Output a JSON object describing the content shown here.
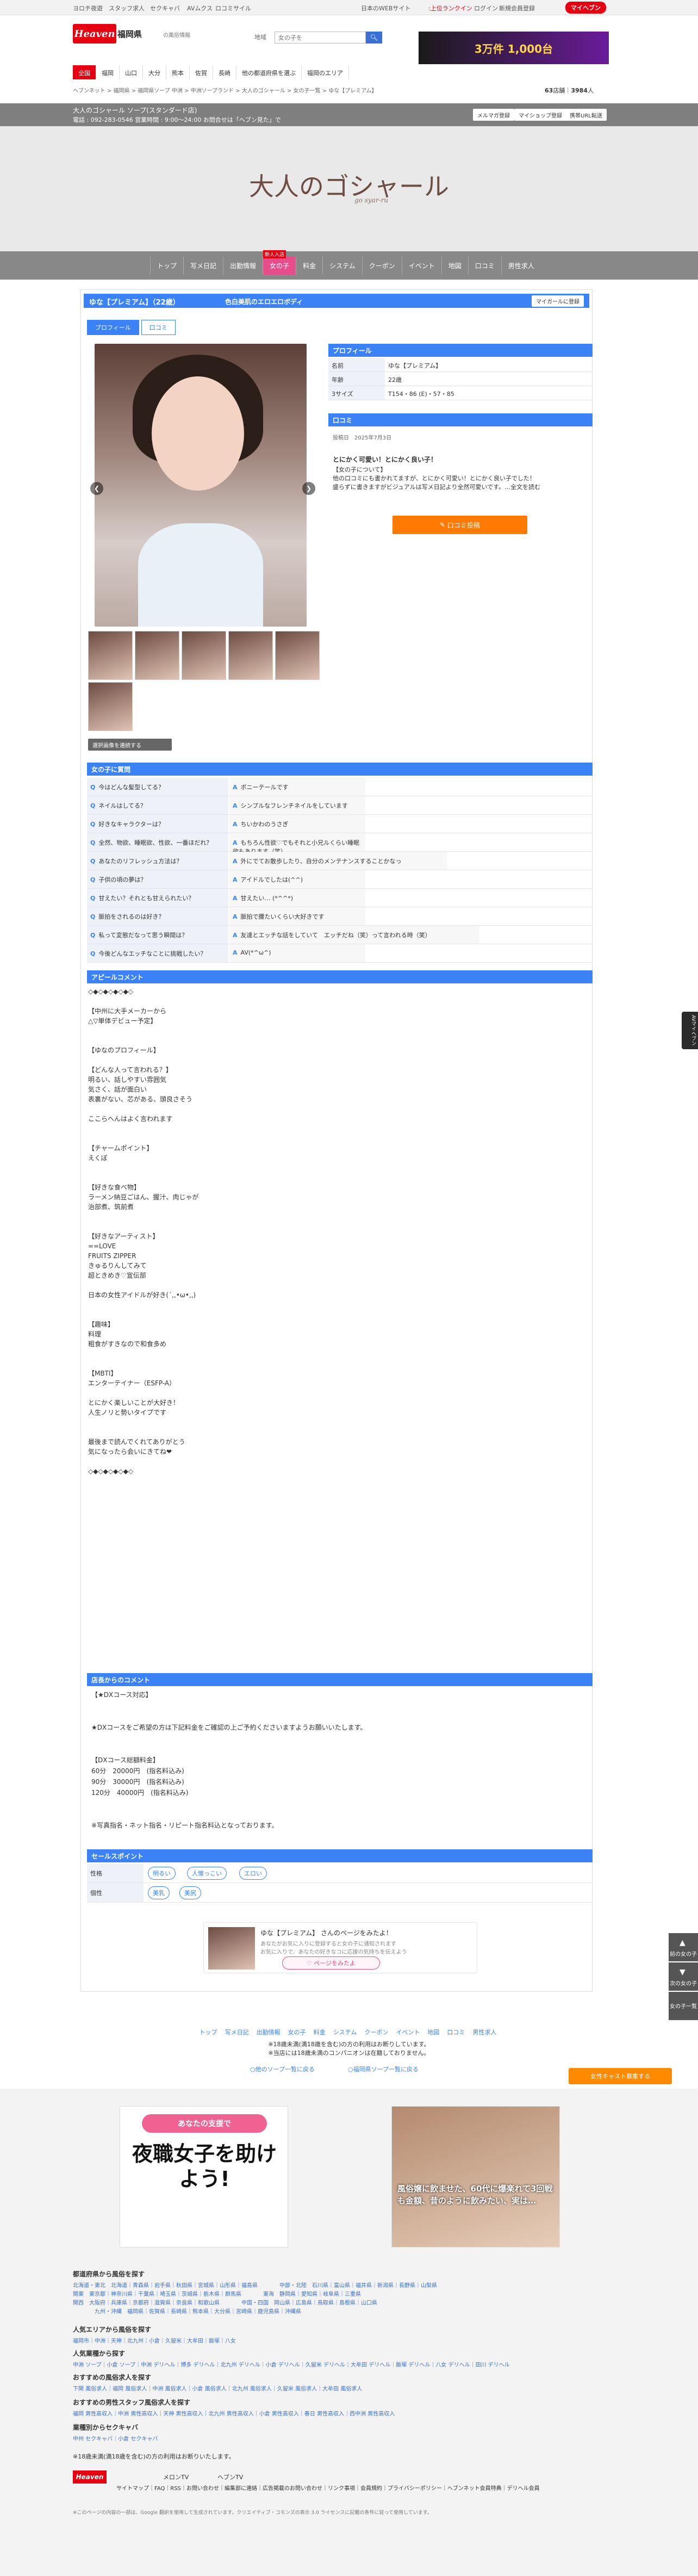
{
  "top": {
    "links": [
      "ヨロチ夜遊",
      "スタッフ求人",
      "セクキャバ",
      "AVムクス",
      "ロコミサイル"
    ],
    "right": [
      "日本のWEBサイト",
      ":上位ランクイン",
      "ログイン",
      "新規会員登録",
      "マイヘブン"
    ]
  },
  "header": {
    "logo": "Heaven",
    "pref": "福岡県",
    "pref_sub": "の風俗情報",
    "search_label": "地域",
    "search_placeholder": "女の子を",
    "banner": "3万件 1,000台",
    "nav": [
      "全国",
      "福岡",
      "山口",
      "大分",
      "熊本",
      "佐賀",
      "長崎",
      "他の都道府県を選ぶ",
      "福岡のエリア"
    ],
    "breadcrumb": "ヘブンネット > 福岡県 > 福岡県ソープ 中洲 > 中洲ソープランド > 大人のゴシャール > 女の子一覧 > ゆな【プレミアム】",
    "shop_count": "63",
    "count_suffix": "店舗",
    "total": "3984",
    "total_suffix": "人"
  },
  "shop": {
    "name": "大人のゴシャール ソープ(スタンダード店)",
    "info": "電話 : 092-283-0546 営業時間 : 9:00〜24:00 お問合せは「ヘブン見た」で",
    "buttons": [
      "メルマガ登録",
      "マイショップ登録",
      "携帯URL転送"
    ],
    "logo_text": "大人のゴシャール",
    "logo_sub": "go syar-ru",
    "nav": [
      "トップ",
      "写メ日記",
      "出勤情報",
      "女の子",
      "料金",
      "システム",
      "クーポン",
      "イベント",
      "地図",
      "口コミ",
      "男性求人"
    ],
    "nav_badge": "新人入店"
  },
  "girl": {
    "title": "ゆな【プレミアム】（22歳）",
    "catch": "色白美肌のエロエロボディ",
    "mag_btn": "マイガールに登録",
    "tabs": [
      "プロフィール",
      "口コミ"
    ],
    "all_photos": "選択画像を連続する"
  },
  "profile": {
    "heading": "プロフィール",
    "rows": [
      {
        "k": "名前",
        "v": "ゆな【プレミアム】"
      },
      {
        "k": "年齢",
        "v": "22歳"
      },
      {
        "k": "3サイズ",
        "v": "T154・86 (E)・57・85"
      }
    ]
  },
  "review": {
    "heading": "口コミ",
    "date_label": "投稿日",
    "date": "2025年7月3日",
    "title": "とにかく可愛い！とにかく良い子！",
    "body": "【女の子について】\n他の口コミにも書かれてますが、とにかく可愛い！とにかく良い子でした！\n盛らずに書きますがビジュアルは写メ日記より全然可愛いです。…全文を読む",
    "btn": "口コミ投稿"
  },
  "qa": {
    "heading": "女の子に質問",
    "items": [
      {
        "q": "今はどんな髪型してる？",
        "a": "ボニーテールです"
      },
      {
        "q": "ネイルはしてる？",
        "a": "シンプルなフレンチネイルをしています"
      },
      {
        "q": "好きなキャラクターは？",
        "a": "ちいかわのうさぎ"
      },
      {
        "q": "全然、物欲、睡眠欲、性欲、一番ほだれ？",
        "a": "もちろん性欲♡でもそれと小兄ルくらい睡眠欲もあります（笑）"
      },
      {
        "q": "あなたのリフレッシュ方法は？",
        "a": "外にでてお散歩したり、自分のメンテナンスすることかなっ"
      },
      {
        "q": "子供の頃の夢は？",
        "a": "アイドルでしたは(^^)"
      },
      {
        "q": "甘えたい？それとも甘えられたい？",
        "a": "甘えたい… (*^^*)"
      },
      {
        "q": "脈拍をされるのは好き？",
        "a": "脈拍で腰たいくらい大好きです"
      },
      {
        "q": "私って変態だなって思う瞬間は？",
        "a": "友達とエッチな話をしていて　エッチだね（笑）って言われる時（笑）"
      },
      {
        "q": "今後どんなエッチなことに挑戦したい？",
        "a": "AV(*^ω^)"
      }
    ]
  },
  "appeal": {
    "heading": "アピールコメント",
    "text": "◇◆◇◆◇◆◇◆◇\n\n【中州に大手メーカーから\n△▽単体デビュー予定】\n\n\n【ゆなのプロフィール】\n\n【どんな人って言われる？】\n明るい、話しやすい雰囲気\n気さく、話が面白い\n表裏がない、芯がある、頭良さそう\n\nここらへんはよく言われます\n\n\n【チャームポイント】\nえくぼ\n\n\n【好きな食べ物】\nラーメン納豆ごはん、握汁、肉じゃが\n治部煮、筑前煮\n\n\n【好きなアーティスト】\n==LOVE\nFRUITS ZIPPER\nきゅるりんしてみて\n超ときめき♡宣伝部\n\n日本の女性アイドルが好き(´,,•ω•,,)\n\n\n【趣味】\n料理\n粗食がすきなので和食多め\n\n\n【MBTI】\nエンターテイナー（ESFP-A）\n\nとにかく楽しいことが大好き！\n人生ノリと勢いタイプです\n\n\n最後まで読んでくれてありがとう\n気になったら会いにきてね❤\n\n◇◆◇◆◇◆◇◆◇"
  },
  "shop_comment": {
    "heading": "店長からのコメント",
    "text": "【★DXコース対応】\n\n\n★DXコースをご希望の方は下記料金をご確認の上ご予約くださいますようお願いいたします。\n\n\n【DXコース総額料金】\n60分　20000円　(指名料込み)\n90分　30000円　(指名料込み)\n120分　40000円　(指名料込み)\n\n\n※写真指名・ネット指名・リピート指名料込となっております。"
  },
  "sales": {
    "heading": "セールスポイント",
    "rows": [
      {
        "k": "性格",
        "tags": [
          "明るい",
          "人懐っこい",
          "エロい"
        ]
      },
      {
        "k": "個性",
        "tags": [
          "美乳",
          "美尻"
        ]
      }
    ]
  },
  "fav": {
    "title": "ゆな【プレミアム】 さんのページをみたよ！",
    "sub": "あなたがお気に入りに登録すると女の子に通知されます\nお気に入りで、あなたの好きなコに応援の気持ちを伝えよう",
    "btn": "ページをみたよ"
  },
  "footer_nav": [
    "トップ",
    "写メ日記",
    "出勤情報",
    "女の子",
    "料金",
    "システム",
    "クーポン",
    "イベント",
    "地図",
    "口コミ",
    "男性求人"
  ],
  "notes": [
    "※18歳未満(満18歳を含む)の方の利用はお断りしています。",
    "※当店には18歳未満のコンパニオンは在籍しておりません。"
  ],
  "links": [
    "○他のソープ一覧に戻る",
    "○福岡県ソープ一覧に戻る"
  ],
  "side": {
    "prev": "前の女の子",
    "next": "次の女の子",
    "list": "女の子一覧",
    "pill": "AVマイヘブン"
  },
  "recruit_btn": "女性キャスト募集する",
  "ads": {
    "ad1_top": "あなたの支援で",
    "ad1_main": "夜職女子を助けよう!",
    "ad2_text": "風俗嬢に飲ませた、60代に爆楽れて3回戦も金額、昔のように飲みたい、実は…"
  },
  "footer": {
    "sections": [
      {
        "h": "都道府県から風俗を探す",
        "l": "北海道・東北　北海道｜青森県｜岩手県｜秋田県｜宮城県｜山形県｜福島県　　　　中部・北陸　石川県｜富山県｜福井県｜新潟県｜長野県｜山梨県\n関東　東京都｜神奈川県｜千葉県｜埼玉県｜茨城県｜栃木県｜群馬県　　　　東海　静岡県｜愛知県｜岐阜県｜三重県\n関西　大阪府｜兵庫県｜京都府｜滋賀県｜奈良県｜和歌山県　　　　中国・四国　岡山県｜広島県｜鳥取県｜島根県｜山口県\n　　　　九州・沖縄　福岡県｜佐賀県｜長崎県｜熊本県｜大分県｜宮崎県｜鹿児島県｜沖縄県"
      },
      {
        "h": "人気エリアから風俗を探す",
        "l": "福岡市｜中洲｜天神｜北九州｜小倉｜久留米｜大牟田｜飯塚｜八女"
      },
      {
        "h": "人気業種から探す",
        "l": "中洲 ソープ｜小倉 ソープ｜中洲 デリヘル｜博多 デリヘル｜北九州 デリヘル｜小倉 デリヘル｜久留米 デリヘル｜大牟田 デリヘル｜飯塚 デリヘル｜八女 デリヘル｜田川 デリヘル"
      },
      {
        "h": "おすすめの風俗求人を探す",
        "l": "下関 風俗求人｜福岡 風俗求人｜中洲 風俗求人｜小倉 風俗求人｜北九州 風俗求人｜久留米 風俗求人｜大牟田 風俗求人"
      },
      {
        "h": "おすすめの男性スタッフ風俗求人を探す",
        "l": "福岡 男性高収入｜中洲 男性高収入｜天神 男性高収入｜北九州 男性高収入｜小倉 男性高収入｜春日 男性高収入｜西中洲 男性高収入"
      },
      {
        "h": "業種別からセクキャバ",
        "l": "中州 セクキャバ｜小倉 セクキャバ"
      }
    ],
    "disclaimer": "※18歳未満(満18歳を含む)の方の利用はお断りいたします。",
    "logos": [
      "Heaven",
      "メロンTV",
      "ヘブンTV"
    ],
    "bottom_links": "サイトマップ｜FAQ｜RSS｜お問い合わせ｜編集部に連絡｜広告掲載のお問い合わせ｜リンク事項｜会員規約｜プライバシーポリシー｜ヘブンネット会員特典｜デリヘル会員",
    "copyright": "※このページの内容の一部は、Google 翻訳を使用して生成されています。クリエイティブ・コモンズの表示 3.0 ライセンスに記載の条件に従って使用しています。"
  }
}
